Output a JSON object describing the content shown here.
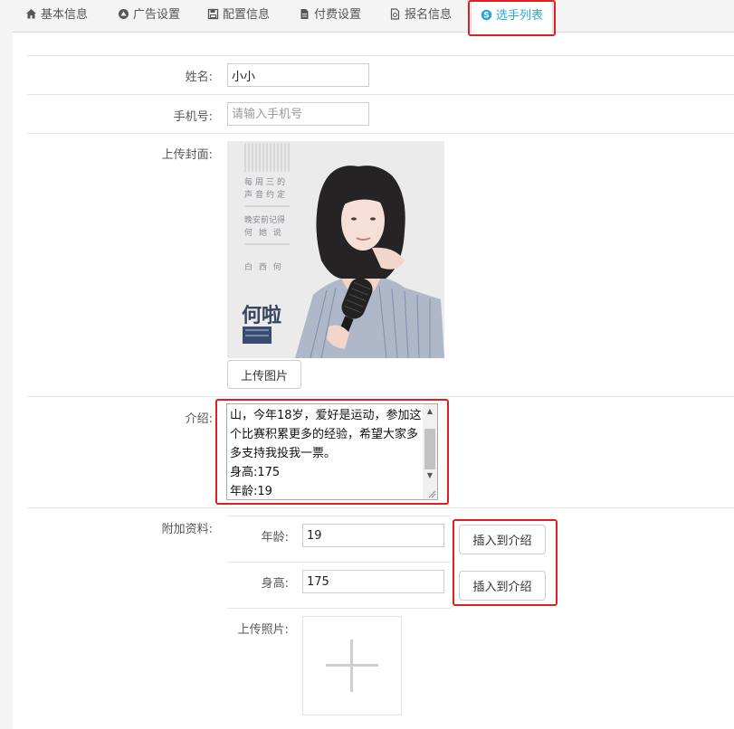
{
  "tabs": [
    {
      "label": "基本信息",
      "icon": "home-icon"
    },
    {
      "label": "广告设置",
      "icon": "ad-icon"
    },
    {
      "label": "配置信息",
      "icon": "save-icon"
    },
    {
      "label": "付费设置",
      "icon": "document-icon"
    },
    {
      "label": "报名信息",
      "icon": "signup-icon"
    },
    {
      "label": "选手列表",
      "icon": "skype-icon",
      "active": true
    }
  ],
  "form": {
    "name_label": "姓名:",
    "name_value": "小小",
    "phone_label": "手机号:",
    "phone_placeholder": "请输入手机号",
    "cover_label": "上传封面:",
    "upload_image_button": "上传图片",
    "intro_label": "介绍:",
    "intro_text": "山，今年18岁，爱好是运动，参加这个比赛积累更多的经验，希望大家多多支持我投我一票。\n身高:175\n年龄:19",
    "extra_label": "附加资料:",
    "extra_fields": [
      {
        "label": "年龄:",
        "value": "19",
        "button": "插入到介绍"
      },
      {
        "label": "身高:",
        "value": "175",
        "button": "插入到介绍"
      }
    ],
    "photo_label": "上传照片:"
  },
  "cover_image": {
    "lines": [
      "每周三的",
      "声音约定",
      "晚安前记得",
      "何 她 说",
      "白 西 何"
    ],
    "logo_text": "何啦"
  },
  "colors": {
    "accent": "#29a8e0",
    "highlight_box": "#e02020",
    "tab_bg": "#f4f4f4",
    "border": "#cccccc"
  }
}
